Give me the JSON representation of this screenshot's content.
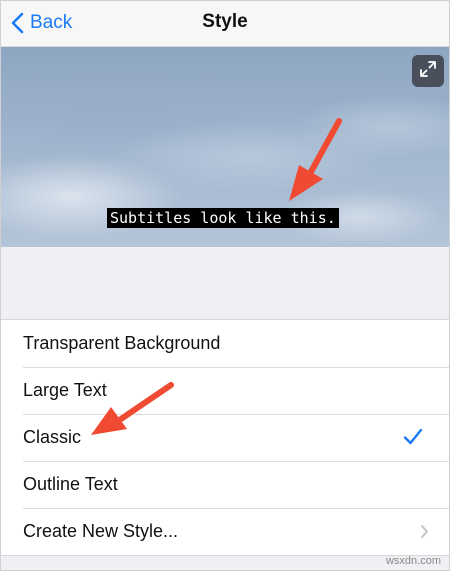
{
  "navbar": {
    "back_label": "Back",
    "title": "Style"
  },
  "preview": {
    "subtitle_text": "Subtitles look like this.",
    "expand_icon": "expand-arrows-icon"
  },
  "list": {
    "items": [
      {
        "label": "Transparent Background"
      },
      {
        "label": "Large Text"
      },
      {
        "label": "Classic",
        "selected": true
      },
      {
        "label": "Outline Text"
      },
      {
        "label": "Create New Style...",
        "disclosure": true
      }
    ]
  },
  "watermark": "wsxdn.com",
  "colors": {
    "accent": "#1a7bf5",
    "annotation_arrow": "#f04a32",
    "list_background": "#ffffff",
    "page_background": "#efeff4"
  }
}
